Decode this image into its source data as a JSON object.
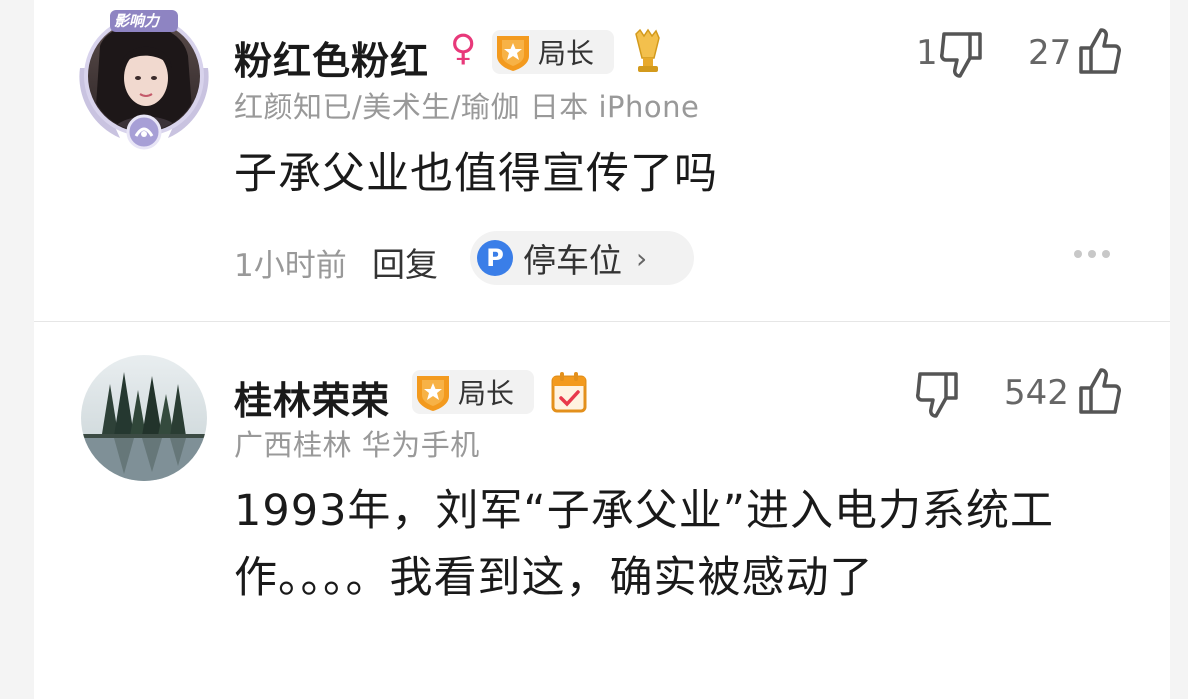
{
  "colors": {
    "accent_blue": "#3a7ee8",
    "female_pink": "#e8397a",
    "badge_orange": "#f39a1e",
    "gray_text": "#999999"
  },
  "comments": [
    {
      "avatar_badge": "影响力",
      "username": "粉红色粉红",
      "gender_symbol": "♀",
      "badge_label": "局长",
      "extra_icon": "trophy-hand-icon",
      "meta": "红颜知已/美术生/瑜伽  日本  iPhone",
      "text": "子承父业也值得宣传了吗",
      "dislike_count": "1",
      "like_count": "27",
      "time": "1小时前",
      "reply_label": "回复",
      "tag": {
        "icon": "P",
        "label": "停车位",
        "chevron": "›"
      },
      "more_icon": "more-dots-icon"
    },
    {
      "username": "桂林荣荣",
      "badge_label": "局长",
      "extra_icon": "calendar-check-icon",
      "meta": "广西桂林  华为手机",
      "text": "1993年，刘军“子承父业”进入电力系统工作。。。。我看到这，确实被感动了",
      "dislike_count": "",
      "like_count": "542"
    }
  ]
}
